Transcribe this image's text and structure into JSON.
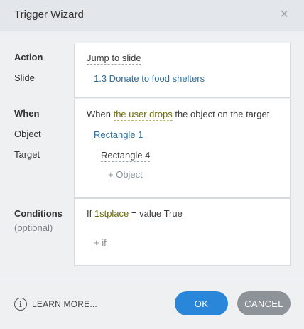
{
  "window": {
    "title": "Trigger Wizard",
    "close_glyph": "×"
  },
  "labels": {
    "action": "Action",
    "slide": "Slide",
    "when": "When",
    "object": "Object",
    "target": "Target",
    "conditions": "Conditions",
    "optional": "(optional)"
  },
  "action_panel": {
    "action_value": "Jump to slide",
    "slide_value": "1.3 Donate to food shelters"
  },
  "when_panel": {
    "prefix": "When",
    "event": "the user drops",
    "suffix": "the object on the target",
    "object_value": "Rectangle 1",
    "target_value": "Rectangle 4",
    "add_object": "+ Object"
  },
  "conditions_panel": {
    "if": "If",
    "variable": "1stplace",
    "operator": "=",
    "value_type": "value",
    "value": "True",
    "add_if": "+ if"
  },
  "footer": {
    "info_glyph": "i",
    "learn_more": "LEARN MORE...",
    "ok": "OK",
    "cancel": "CANCEL"
  },
  "colors": {
    "primary_button": "#2a86d8",
    "secondary_button": "#8e9399",
    "link": "#2b6d9c",
    "variable": "#6b6a00"
  }
}
